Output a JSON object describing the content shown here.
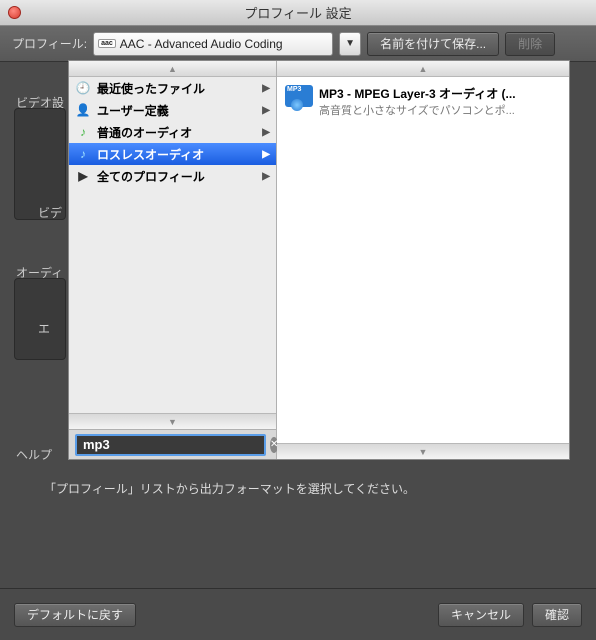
{
  "window": {
    "title": "プロフィール 設定"
  },
  "toolbar": {
    "profile_label": "プロフィール:",
    "profile_value": "AAC - Advanced Audio Coding",
    "save_as": "名前を付けて保存...",
    "delete": "削除"
  },
  "bg": {
    "video": "ビデオ設",
    "video2": "ビデ",
    "audio": "オーディ",
    "audio2": "エ",
    "help": "ヘルプ"
  },
  "categories": [
    {
      "label": "最近使ったファイル",
      "icon": "🕘",
      "selected": false
    },
    {
      "label": "ユーザー定義",
      "icon": "👤",
      "selected": false
    },
    {
      "label": "普通のオーディオ",
      "icon": "🎵",
      "selected": false
    },
    {
      "label": "ロスレスオーディオ",
      "icon": "🎵",
      "selected": true
    },
    {
      "label": "全てのプロフィール",
      "icon": "▶",
      "selected": false
    }
  ],
  "results": [
    {
      "title": "MP3 - MPEG Layer-3 オーディオ (...",
      "desc": "高音質と小さなサイズでパソコンとポ..."
    }
  ],
  "search": {
    "value": "mp3"
  },
  "hint": "「プロフィール」リストから出力フォーマットを選択してください。",
  "footer": {
    "reset": "デフォルトに戻す",
    "cancel": "キャンセル",
    "ok": "確認"
  }
}
